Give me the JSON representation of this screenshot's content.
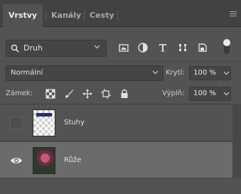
{
  "tabs": [
    {
      "label": "Vrstvy"
    },
    {
      "label": "Kanály"
    },
    {
      "label": "Cesty"
    }
  ],
  "filter": {
    "label": "Druh",
    "icon": "search-icon"
  },
  "filter_icons": [
    "image-filter-icon",
    "adjustment-filter-icon",
    "type-filter-icon",
    "shape-filter-icon",
    "smart-object-filter-icon"
  ],
  "blend_mode": {
    "value": "Normální"
  },
  "opacity": {
    "label": "Krytí:",
    "value": "100 %"
  },
  "lock": {
    "label": "Zámek:",
    "icons": [
      "lock-transparent-icon",
      "lock-image-icon",
      "lock-position-icon",
      "lock-artboard-icon",
      "lock-all-icon"
    ]
  },
  "fill": {
    "label": "Výplň:",
    "value": "100 %"
  },
  "layers": [
    {
      "name": "Stuhy",
      "visible": false,
      "selected": false
    },
    {
      "name": "Růže",
      "visible": true,
      "selected": true
    }
  ],
  "colors": {
    "panel": "#535353",
    "tabbar": "#424242",
    "selected_layer": "#6b6b6b"
  }
}
